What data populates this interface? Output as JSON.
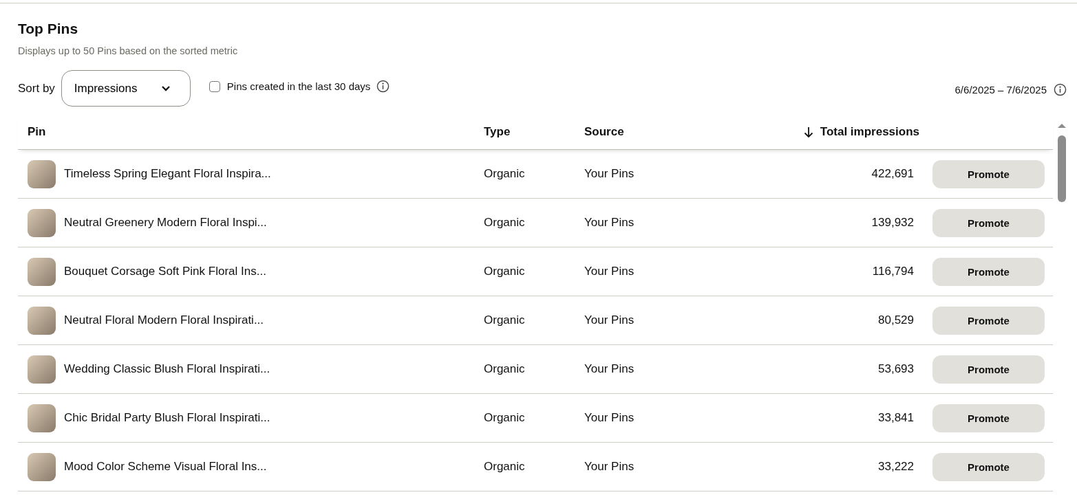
{
  "section": {
    "title": "Top Pins",
    "subtitle": "Displays up to 50 Pins based on the sorted metric"
  },
  "controls": {
    "sort_label": "Sort by",
    "sort_value": "Impressions",
    "filter_checkbox": {
      "label": "Pins created in the last 30 days",
      "checked": false
    },
    "date_range": "6/6/2025 – 7/6/2025"
  },
  "table": {
    "columns": [
      {
        "label": "Pin",
        "sorted": false
      },
      {
        "label": "Type",
        "sorted": false
      },
      {
        "label": "Source",
        "sorted": false
      },
      {
        "label": "Total impressions",
        "sorted": true
      }
    ],
    "rows": [
      {
        "title": "Timeless Spring Elegant Floral Inspira...",
        "type": "Organic",
        "source": "Your Pins",
        "impressions": "422,691",
        "action": "Promote"
      },
      {
        "title": "Neutral Greenery Modern Floral Inspi...",
        "type": "Organic",
        "source": "Your Pins",
        "impressions": "139,932",
        "action": "Promote"
      },
      {
        "title": "Bouquet Corsage Soft Pink Floral Ins...",
        "type": "Organic",
        "source": "Your Pins",
        "impressions": "116,794",
        "action": "Promote"
      },
      {
        "title": "Neutral Floral Modern Floral Inspirati...",
        "type": "Organic",
        "source": "Your Pins",
        "impressions": "80,529",
        "action": "Promote"
      },
      {
        "title": "Wedding Classic Blush Floral Inspirati...",
        "type": "Organic",
        "source": "Your Pins",
        "impressions": "53,693",
        "action": "Promote"
      },
      {
        "title": "Chic Bridal Party Blush Floral Inspirati...",
        "type": "Organic",
        "source": "Your Pins",
        "impressions": "33,841",
        "action": "Promote"
      },
      {
        "title": "Mood Color Scheme Visual Floral Ins...",
        "type": "Organic",
        "source": "Your Pins",
        "impressions": "33,222",
        "action": "Promote"
      }
    ]
  }
}
